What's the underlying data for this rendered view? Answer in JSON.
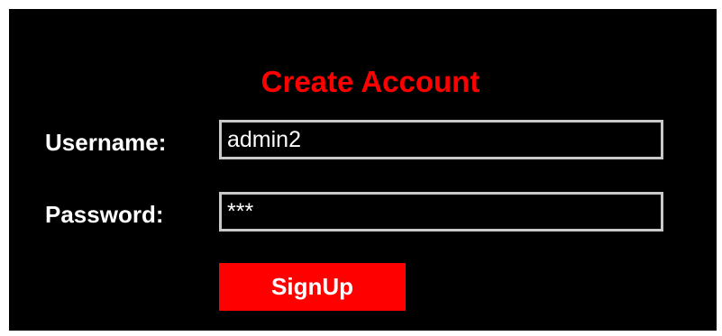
{
  "form": {
    "title": "Create Account",
    "username_label": "Username:",
    "username_value": "admin2",
    "password_label": "Password:",
    "password_value": "***",
    "submit_label": "SignUp"
  },
  "colors": {
    "background": "#000000",
    "title": "#ff0000",
    "button": "#ff0000",
    "field_border": "#c9c9c9",
    "text": "#ffffff"
  }
}
